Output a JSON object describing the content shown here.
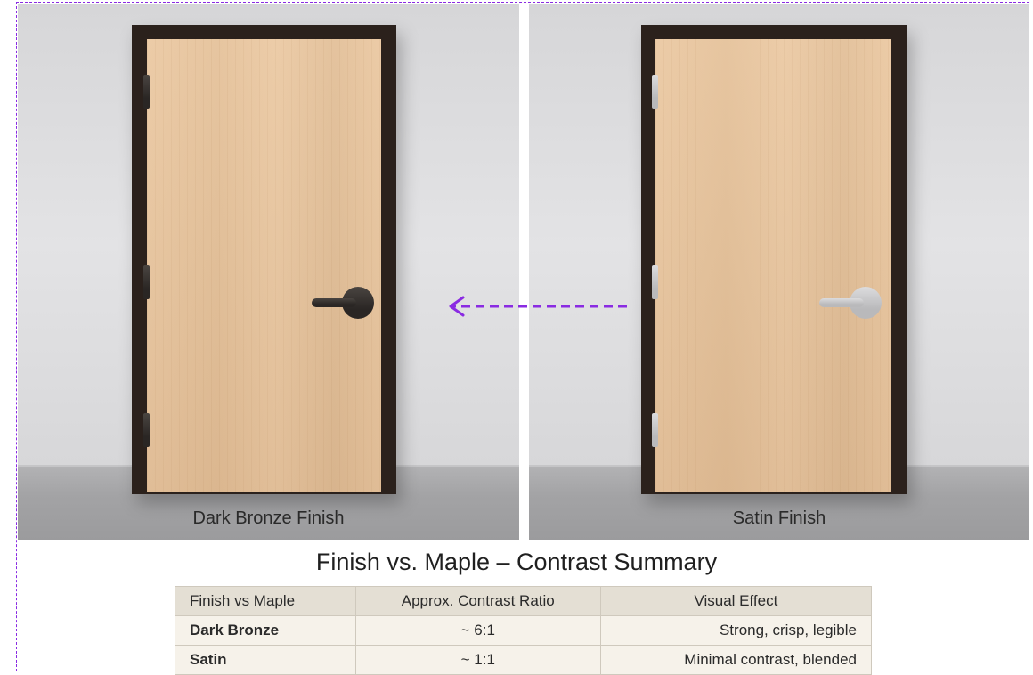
{
  "panels": [
    {
      "caption": "Dark Bronze Finish",
      "hardware_color": "#2a2624",
      "hardware_highlight": "#4a4541"
    },
    {
      "caption": "Satin Finish",
      "hardware_color": "#b9b9bb",
      "hardware_highlight": "#dcdcde"
    }
  ],
  "colors": {
    "frame": "#2b211c",
    "maple": "#e5c29b",
    "accent": "#8a2be2"
  },
  "annotation": {
    "arrow_icon": "dashed-left-arrow"
  },
  "summary": {
    "title": "Finish vs. Maple – Contrast Summary",
    "headers": [
      "Finish vs Maple",
      "Approx. Contrast Ratio",
      "Visual Effect"
    ],
    "rows": [
      [
        "Dark Bronze",
        "~ 6:1",
        "Strong, crisp, legible"
      ],
      [
        "Satin",
        "~ 1:1",
        "Minimal contrast, blended"
      ]
    ]
  }
}
